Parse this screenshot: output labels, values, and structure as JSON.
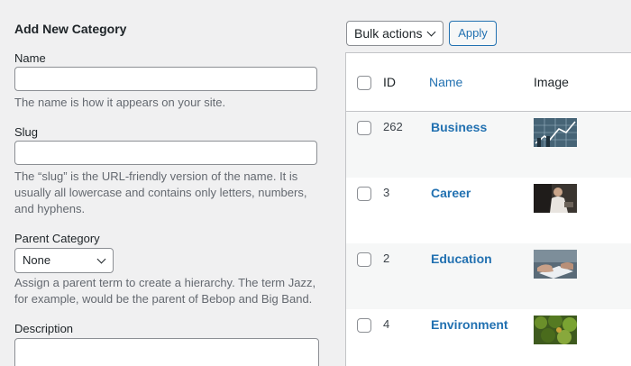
{
  "form": {
    "title": "Add New Category",
    "name_label": "Name",
    "name_help": "The name is how it appears on your site.",
    "slug_label": "Slug",
    "slug_help": "The “slug” is the URL-friendly version of the name. It is usually all lowercase and contains only letters, numbers, and hyphens.",
    "parent_label": "Parent Category",
    "parent_selected": "None",
    "parent_help": "Assign a parent term to create a hierarchy. The term Jazz, for example, would be the parent of Bebop and Big Band.",
    "description_label": "Description"
  },
  "toolbar": {
    "bulk_actions": "Bulk actions",
    "apply": "Apply"
  },
  "table": {
    "headers": {
      "id": "ID",
      "name": "Name",
      "image": "Image"
    },
    "rows": [
      {
        "id": "262",
        "name": "Business",
        "image": "business-chart-thumbnail"
      },
      {
        "id": "3",
        "name": "Career",
        "image": "career-person-thumbnail"
      },
      {
        "id": "2",
        "name": "Education",
        "image": "education-hands-thumbnail"
      },
      {
        "id": "4",
        "name": "Environment",
        "image": "environment-trees-thumbnail"
      }
    ]
  },
  "colors": {
    "link": "#2271b1",
    "background": "#f0f0f1",
    "help_text": "#646970",
    "border": "#8c8f94"
  }
}
